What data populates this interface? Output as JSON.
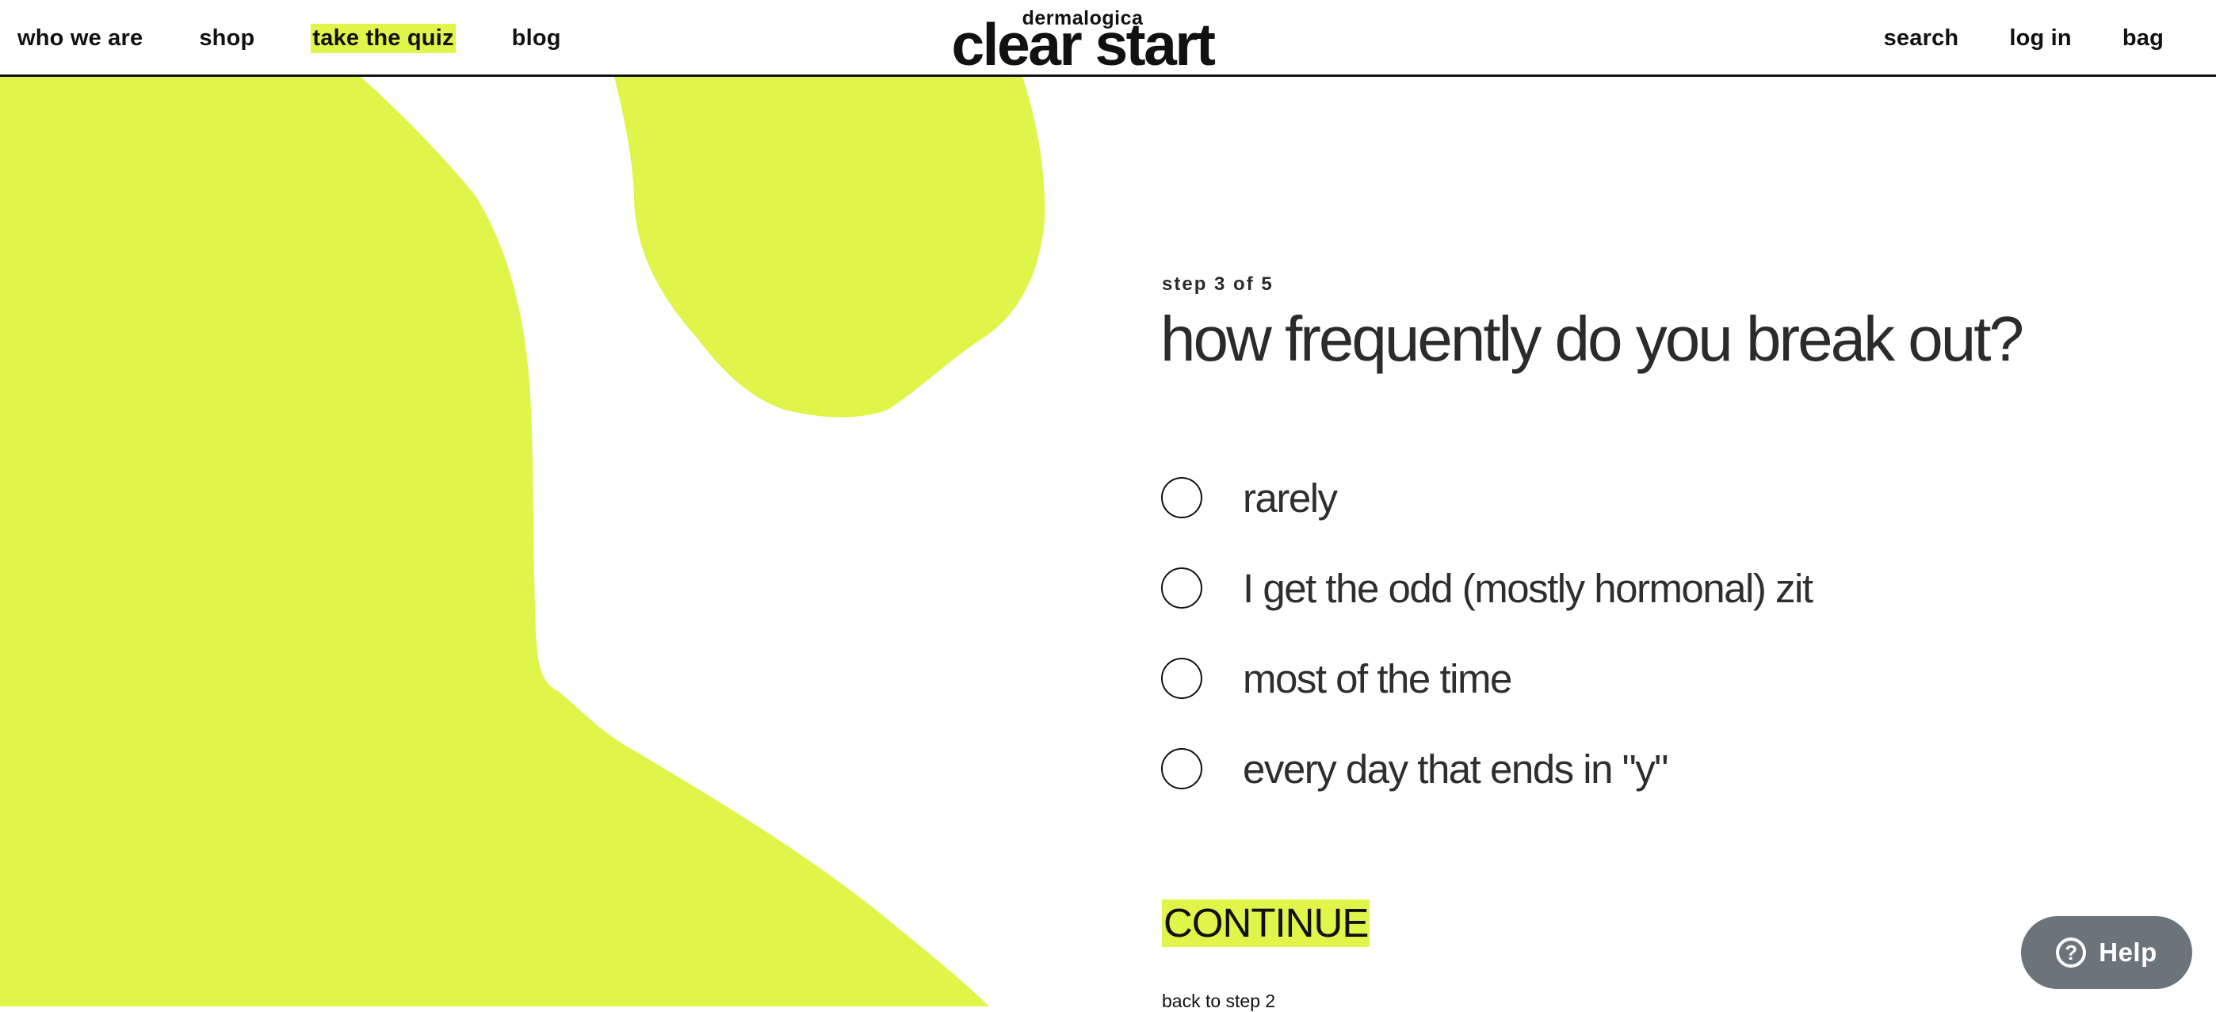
{
  "header": {
    "nav_left": [
      "who we are",
      "shop",
      "take the quiz",
      "blog"
    ],
    "logo": {
      "small": "dermalogica",
      "big": "clear start"
    },
    "nav_right": [
      "search",
      "log in",
      "bag"
    ]
  },
  "quiz": {
    "step": "step 3 of 5",
    "question": "how frequently do you break out?",
    "options": [
      "rarely",
      "I get the odd (mostly hormonal) zit",
      "most of the time",
      "every day that ends in \"y\""
    ],
    "continue_label": "CONTINUE",
    "back_label": "back to step 2"
  },
  "help": {
    "label": "Help",
    "icon": "question-circle-icon"
  },
  "colors": {
    "accent": "#dff54a",
    "text": "#2b2b2b",
    "help_bg": "#6b747b"
  }
}
